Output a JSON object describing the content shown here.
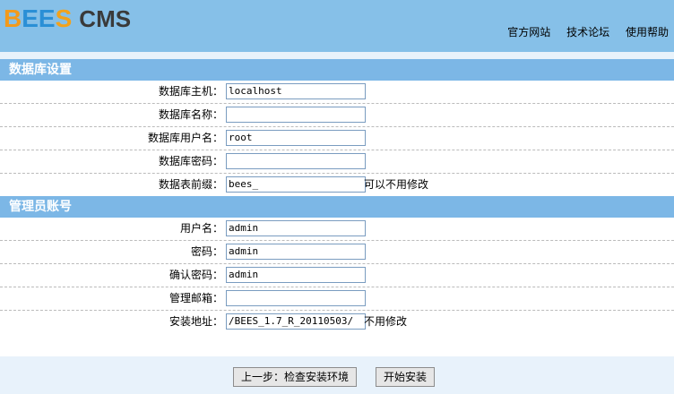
{
  "header": {
    "logo_letters": [
      "B",
      "E",
      "E",
      "S"
    ],
    "logo_suffix": "CMS",
    "links": [
      "官方网站",
      "技术论坛",
      "使用帮助"
    ]
  },
  "db_section": {
    "title": "数据库设置",
    "fields": [
      {
        "label": "数据库主机：",
        "value": "localhost",
        "note": ""
      },
      {
        "label": "数据库名称：",
        "value": "",
        "note": ""
      },
      {
        "label": "数据库用户名：",
        "value": "root",
        "note": ""
      },
      {
        "label": "数据库密码：",
        "value": "",
        "note": ""
      },
      {
        "label": "数据表前缀：",
        "value": "bees_",
        "note": "可以不用修改"
      }
    ]
  },
  "admin_section": {
    "title": "管理员账号",
    "fields": [
      {
        "label": "用户名：",
        "value": "admin",
        "note": ""
      },
      {
        "label": "密码：",
        "value": "admin",
        "note": ""
      },
      {
        "label": "确认密码：",
        "value": "admin",
        "note": ""
      },
      {
        "label": "管理邮箱：",
        "value": "",
        "note": ""
      },
      {
        "label": "安装地址：",
        "value": "/BEES_1.7_R_20110503/",
        "note": "不用修改"
      }
    ]
  },
  "buttons": {
    "back": "上一步：检查安装环境",
    "install": "开始安装"
  },
  "colors": {
    "header_bg": "#86c0e8",
    "section_bg": "#7cb7e6",
    "footer_bg": "#e8f2fb"
  }
}
